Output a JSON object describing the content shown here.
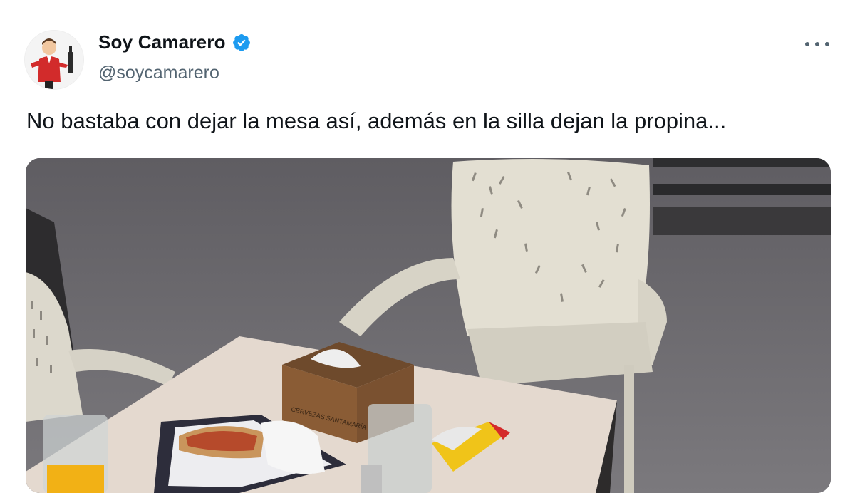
{
  "author": {
    "display_name": "Soy Camarero",
    "handle": "@soycamarero",
    "verified": true,
    "verified_color": "#1d9bf0",
    "avatar_icon": "waiter-avatar-icon"
  },
  "tweet": {
    "text": "No bastaba con dejar la mesa así, además en la silla dejan la propina..."
  },
  "menu": {
    "icon": "more-options-icon"
  },
  "media": {
    "alt": "",
    "napkin_box_text": "CERVEZAS SANTAMARÍA"
  },
  "colors": {
    "text_primary": "#0f1419",
    "text_secondary": "#536471"
  }
}
